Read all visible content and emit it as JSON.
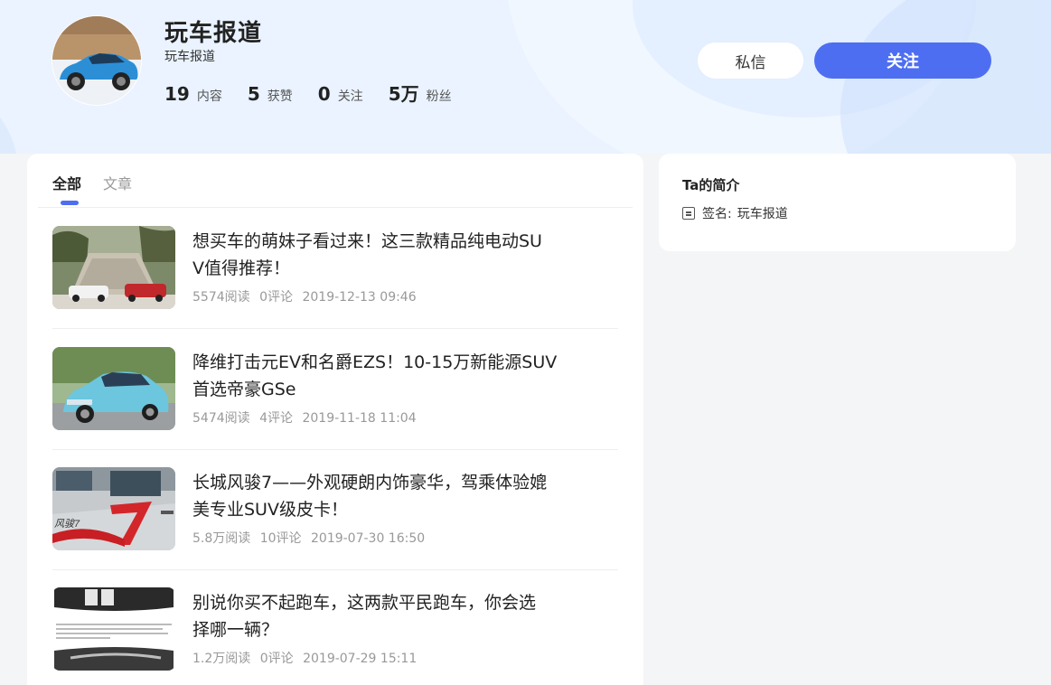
{
  "profile": {
    "name": "玩车报道",
    "subtitle": "玩车报道",
    "stats": [
      {
        "num": "19",
        "label": "内容"
      },
      {
        "num": "5",
        "label": "获赞"
      },
      {
        "num": "0",
        "label": "关注"
      },
      {
        "num": "5万",
        "label": "粉丝"
      }
    ],
    "message_label": "私信",
    "follow_label": "关注"
  },
  "tabs": [
    {
      "label": "全部",
      "active": true
    },
    {
      "label": "文章",
      "active": false
    }
  ],
  "articles": [
    {
      "title": "想买车的萌妹子看过来！这三款精品纯电动SUV值得推荐！",
      "title_line1": "想买车的萌妹子看过来！这三款精品纯电动SU",
      "title_line2": "V值得推荐！",
      "reads": "5574阅读",
      "comments": "0评论",
      "time": "2019-12-13 09:46"
    },
    {
      "title": "降维打击元EV和名爵EZS！10-15万新能源SUV首选帝豪GSe",
      "title_line1": "降维打击元EV和名爵EZS！10-15万新能源SUV",
      "title_line2": "首选帝豪GSe",
      "reads": "5474阅读",
      "comments": "4评论",
      "time": "2019-11-18 11:04"
    },
    {
      "title": "长城风骏7——外观硬朗内饰豪华，驾乘体验媲美专业SUV级皮卡！",
      "title_line1": "长城风骏7——外观硬朗内饰豪华，驾乘体验媲",
      "title_line2": "美专业SUV级皮卡！",
      "reads": "5.8万阅读",
      "comments": "10评论",
      "time": "2019-07-30 16:50"
    },
    {
      "title": "别说你买不起跑车，这两款平民跑车，你会选择哪一辆？",
      "title_line1": "别说你买不起跑车，这两款平民跑车，你会选",
      "title_line2": "择哪一辆？",
      "reads": "1.2万阅读",
      "comments": "0评论",
      "time": "2019-07-29 15:11"
    }
  ],
  "sidebar": {
    "title": "Ta的简介",
    "signature_label": "签名:",
    "signature_value": "玩车报道"
  },
  "colors": {
    "accent": "#4e6ef2",
    "hero_bg": "#eaf3ff",
    "page_bg": "#f4f5f7"
  }
}
